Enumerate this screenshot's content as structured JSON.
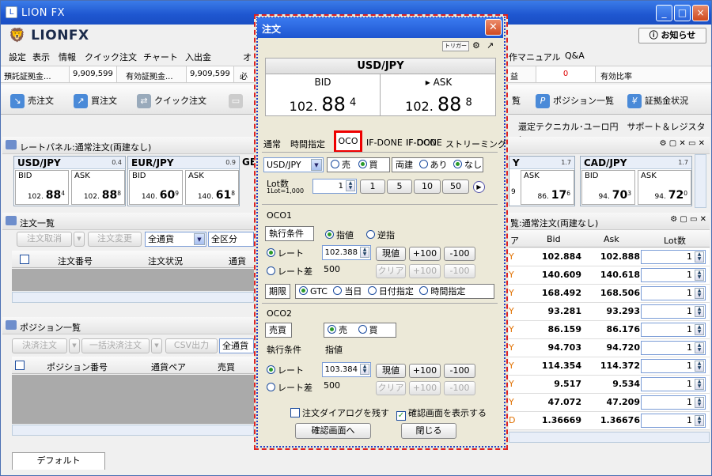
{
  "window": {
    "title": "LION FX",
    "buttons": [
      "_",
      "□",
      "×"
    ]
  },
  "logo": "LIONFX",
  "notice_button": "お知らせ",
  "menu": [
    "設定",
    "表示",
    "情報",
    "クイック注文",
    "チャート",
    "入出金",
    "オ",
    "作マニュアル",
    "Q&A"
  ],
  "account": {
    "label1": "預託証拠金...",
    "value1": "9,909,599",
    "label2": "有効証拠金...",
    "value2": "9,909,599",
    "label3": "必",
    "label4": "益",
    "value4": "0",
    "label5": "有効比率"
  },
  "toolbar": {
    "sell": "売注文",
    "buy": "買注文",
    "quick": "クイック注文",
    "list": "覧",
    "positions": "ポジション一覧",
    "margin": "証拠金状況"
  },
  "links": "還定テクニカル･ユーロ円　サポート＆レジスタン",
  "rate_panel": {
    "title": "レートパネル:通常注文(両建なし)",
    "tiles": [
      {
        "pair": "USD/JPY",
        "spread": "0.4",
        "bid_pre": "102.",
        "bid_big": "88",
        "bid_sub": "4",
        "ask_pre": "102.",
        "ask_big": "88",
        "ask_sub": "8"
      },
      {
        "pair": "EUR/JPY",
        "spread": "0.9",
        "bid_pre": "140.",
        "bid_big": "60",
        "bid_sub": "9",
        "ask_pre": "140.",
        "ask_big": "61",
        "ask_sub": "8"
      }
    ],
    "bid_label": "BID",
    "ask_label": "ASK",
    "partial": "GB",
    "right_tiles": [
      {
        "pair": "Y",
        "spread": "1.7",
        "ask_label": "ASK",
        "bid_pre": "9",
        "ask_pre": "86.",
        "ask_big": "17",
        "ask_sub": "6"
      },
      {
        "pair": "CAD/JPY",
        "spread": "1.7",
        "bid_pre": "94.",
        "bid_big": "70",
        "bid_sub": "3",
        "ask_pre": "94.",
        "ask_big": "72",
        "ask_sub": "0"
      }
    ]
  },
  "order_list": {
    "title": "注文一覧",
    "cancel": "注文取消",
    "modify": "注文変更",
    "currency": "全通貨",
    "category": "全区分",
    "col_no": "注文番号",
    "col_status": "注文状況",
    "col_pair": "通貨ペ"
  },
  "position_list": {
    "title": "ポジション一覧",
    "settle": "決済注文",
    "bulk_settle": "一括決済注文",
    "csv": "CSV出力",
    "currency": "全通貨",
    "col_no": "ポジション番号",
    "col_pair": "通貨ペア",
    "col_side": "売買"
  },
  "footer_tab": "デフォルト",
  "right_table": {
    "title": "覧:通常注文(両建なし)",
    "col_pair": "ア",
    "col_bid": "Bid",
    "col_ask": "Ask",
    "col_lot": "Lot数",
    "rows": [
      {
        "p": "Y",
        "bid": "102.884",
        "ask": "102.888",
        "lot": "1"
      },
      {
        "p": "Y",
        "bid": "140.609",
        "ask": "140.618",
        "lot": "1"
      },
      {
        "p": "Y",
        "bid": "168.492",
        "ask": "168.506",
        "lot": "1"
      },
      {
        "p": "Y",
        "bid": "93.281",
        "ask": "93.293",
        "lot": "1"
      },
      {
        "p": "Y",
        "bid": "86.159",
        "ask": "86.176",
        "lot": "1"
      },
      {
        "p": "Y",
        "bid": "94.703",
        "ask": "94.720",
        "lot": "1"
      },
      {
        "p": "Y",
        "bid": "114.354",
        "ask": "114.372",
        "lot": "1"
      },
      {
        "p": "Y",
        "bid": "9.517",
        "ask": "9.534",
        "lot": "1"
      },
      {
        "p": "Y",
        "bid": "47.072",
        "ask": "47.209",
        "lot": "1"
      },
      {
        "p": "D",
        "bid": "1.36669",
        "ask": "1.36676",
        "lot": "1"
      }
    ]
  },
  "dialog": {
    "title": "注文",
    "trigger": "トリガー",
    "pair_header": "USD/JPY",
    "bid_label": "BID",
    "ask_label": "ASK",
    "bid": {
      "pre": "102.",
      "big": "88",
      "sub": "4"
    },
    "ask": {
      "pre": "102.",
      "big": "88",
      "sub": "8"
    },
    "tabs": [
      "通常",
      "時間指定",
      "OCO",
      "IF-DONE",
      "IF-OCO",
      "ストリーミング"
    ],
    "pair_select": "USD/JPY",
    "sell": "売",
    "buy": "買",
    "hedge": "両建",
    "hedge_yes": "あり",
    "hedge_no": "なし",
    "lot_label": "Lot数",
    "lot_note": "1Lot=1,000",
    "lot": "1",
    "lot_btns": [
      "1",
      "5",
      "10",
      "50"
    ],
    "oco1": {
      "title": "OCO1",
      "cond_label": "執行条件",
      "cond_limit": "指値",
      "cond_stop": "逆指",
      "rate": "レート",
      "rate_value": "102.388",
      "current": "現値",
      "plus": "+100",
      "minus": "-100",
      "diff": "レート差",
      "diff_value": "500",
      "clear": "クリア"
    },
    "expiry": {
      "label": "期限",
      "gtc": "GTC",
      "today": "当日",
      "date": "日付指定",
      "time": "時間指定"
    },
    "oco2": {
      "title": "OCO2",
      "side_label": "売買",
      "sell": "売",
      "buy": "買",
      "cond_label": "執行条件",
      "cond_value": "指値",
      "rate": "レート",
      "rate_value": "103.384",
      "current": "現値",
      "plus": "+100",
      "minus": "-100",
      "diff": "レート差",
      "diff_value": "500",
      "clear": "クリア"
    },
    "keep_dialog": "注文ダイアログを残す",
    "show_confirm": "確認画面を表示する",
    "confirm_btn": "確認画面へ",
    "close_btn": "閉じる"
  }
}
